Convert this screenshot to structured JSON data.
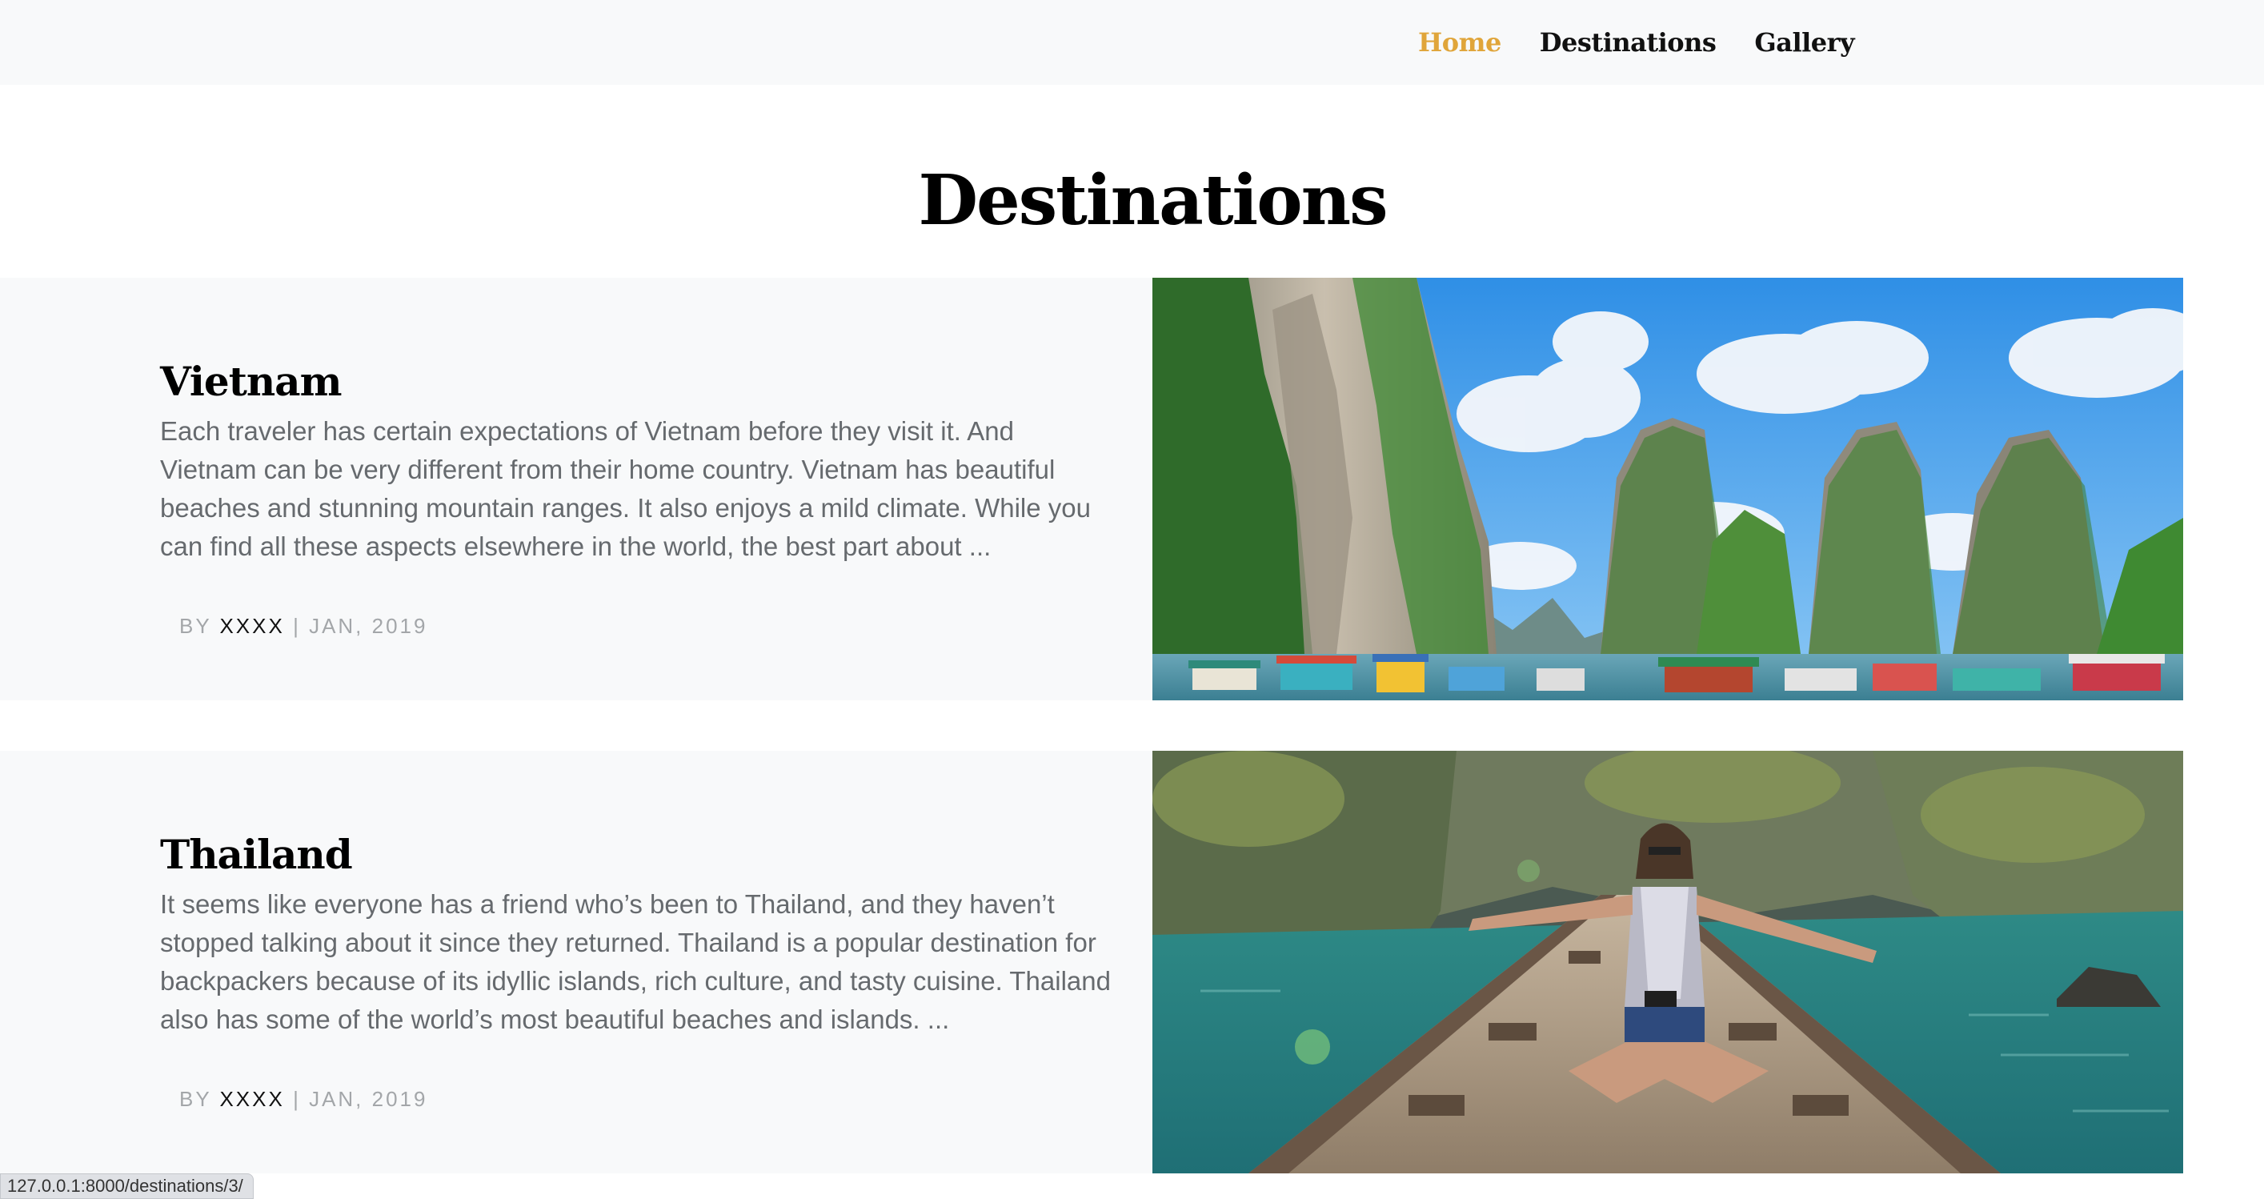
{
  "nav": {
    "items": [
      {
        "label": "Home",
        "active": true
      },
      {
        "label": "Destinations",
        "active": false
      },
      {
        "label": "Gallery",
        "active": false
      }
    ],
    "active_color": "#e0a53a"
  },
  "page": {
    "title": "Destinations"
  },
  "destinations": [
    {
      "title": "Vietnam",
      "description": "Each traveler has certain expectations of Vietnam before they visit it. And Vietnam can be very different from their home country. Vietnam has beautiful beaches and stunning mountain ranges. It also enjoys a mild climate. While you can find all these aspects elsewhere in the world, the best part about ...",
      "by_label": "BY",
      "author": "XXXX",
      "separator": "|",
      "date": "JAN, 2019",
      "image": "vietnam-karst-bay-photo"
    },
    {
      "title": "Thailand",
      "description": "It seems like everyone has a friend who’s been to Thailand, and they haven’t stopped talking about it since they returned. Thailand is a popular destination for backpackers because of its idyllic islands, rich culture, and tasty cuisine. Thailand also has some of the world’s most beautiful beaches and islands. ...",
      "by_label": "BY",
      "author": "XXXX",
      "separator": "|",
      "date": "JAN, 2019",
      "image": "thailand-boat-traveler-photo"
    }
  ],
  "status_bar": {
    "url": "127.0.0.1:8000/destinations/3/"
  }
}
